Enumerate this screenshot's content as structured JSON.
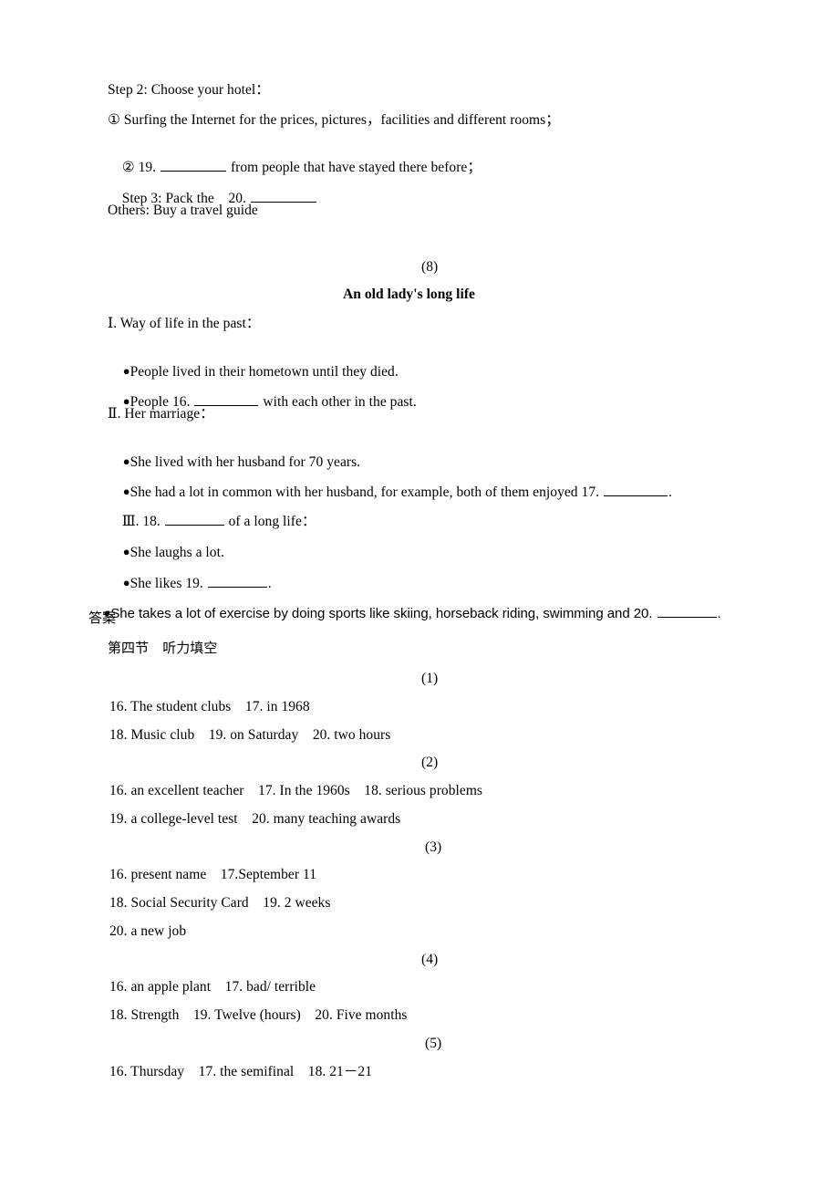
{
  "document": {
    "blank_marker": "__________",
    "top_block": {
      "lines": [
        {
          "id": "step2",
          "text": "Step 2: Choose your hotel："
        },
        {
          "id": "item1",
          "text": "① Surfing the Internet for the prices, pictures，facilities and different rooms；"
        },
        {
          "id": "item2_prefix",
          "text": "② 19. ",
          "text_after": " from people that have stayed there before；"
        },
        {
          "id": "step3_prefix",
          "text": "Step 3: Pack the    20. ",
          "text_after": ""
        },
        {
          "id": "others",
          "text": "Others: Buy a travel guide"
        }
      ]
    },
    "section8": {
      "number": "(8)",
      "title": "An old lady's long life",
      "part1_heading": "Ⅰ. Way of life in the past：",
      "part1_bullets": [
        {
          "marker": "●",
          "before": "People lived in their hometown until they died.",
          "after": ""
        },
        {
          "marker": "●",
          "before": "People 16. ",
          "after": " with each other in the past."
        }
      ],
      "part2_heading": "Ⅱ. Her marriage：",
      "part2_bullets": [
        {
          "marker": "●",
          "before": "She lived with her husband for 70 years.",
          "after": ""
        },
        {
          "marker": "●",
          "before": "She had a lot in common with her husband, for example, both of them enjoyed 17. ",
          "after": "."
        }
      ],
      "part3_heading_before": "Ⅲ. 18. ",
      "part3_heading_after": " of a long life：",
      "part3_bullets": [
        {
          "marker": "●",
          "before": "She laughs a lot.",
          "after": ""
        },
        {
          "marker": "●",
          "before": "She likes 19. ",
          "after": "."
        }
      ],
      "part3_last_bullet": {
        "marker": "●",
        "before": "She takes a lot of exercise by doing sports like skiing, horseback riding, swimming and 20. ",
        "after": "."
      }
    },
    "answers": {
      "heading": "答案",
      "subheading": "第四节　听力填空",
      "groups": [
        {
          "number": "(1)",
          "lines": [
            "16. The student clubs　17. in 1968",
            "18. Music club　19. on Saturday　20. two hours"
          ]
        },
        {
          "number": "(2)",
          "lines": [
            "16. an excellent teacher　17. In the 1960s　18. serious problems",
            "19. a college-level test　20. many teaching awards"
          ]
        },
        {
          "number": "(3)",
          "lines": [
            "16. present name　17.September 11",
            "18. Social Security Card　19. 2 weeks",
            "20. a new job"
          ]
        },
        {
          "number": "(4)",
          "lines": [
            "16. an apple plant　17. bad/ terrible",
            "18. Strength　19. Twelve (hours)　20. Five months"
          ]
        },
        {
          "number": "(5)",
          "lines": [
            "16. Thursday　17. the semifinal　18. 21－21"
          ]
        }
      ]
    }
  }
}
